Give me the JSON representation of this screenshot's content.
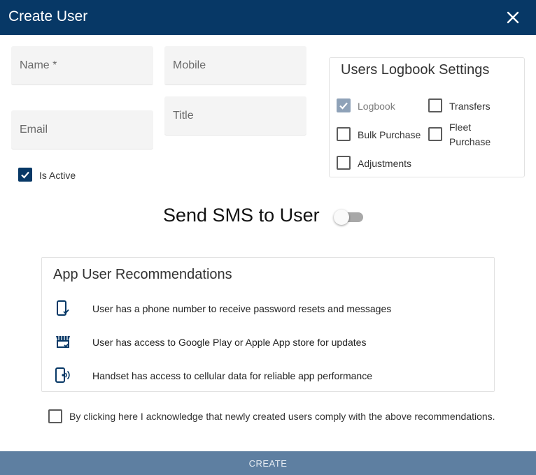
{
  "dialog": {
    "title": "Create User",
    "header_color": "#073866"
  },
  "fields": {
    "name_placeholder": "Name *",
    "mobile_placeholder": "Mobile",
    "title_placeholder": "Title",
    "email_placeholder": "Email"
  },
  "is_active": {
    "label": "Is Active",
    "checked": true
  },
  "logbook_settings": {
    "title": "Users Logbook Settings",
    "options": [
      {
        "label": "Logbook",
        "checked": true,
        "disabled": true
      },
      {
        "label": "Transfers",
        "checked": false
      },
      {
        "label": "Bulk Purchase",
        "checked": false
      },
      {
        "label": "Fleet",
        "label_line2": "Purchase",
        "checked": false
      },
      {
        "label": "Adjustments",
        "checked": false
      }
    ]
  },
  "sms": {
    "label": "Send SMS to User",
    "enabled": false
  },
  "recommendations": {
    "title": "App User Recommendations",
    "items": [
      {
        "icon": "phone-check-icon",
        "text": "User has a phone number to receive password resets and messages"
      },
      {
        "icon": "store-check-icon",
        "text": "User has access to Google Play or Apple App store for updates"
      },
      {
        "icon": "phone-signal-icon",
        "text": "Handset has access to cellular data for reliable app performance"
      }
    ]
  },
  "acknowledge": {
    "label": "By clicking here I acknowledge that newly created users comply with the above recommendations.",
    "checked": false
  },
  "actions": {
    "create_label": "CREATE",
    "create_color": "#5e7fa1"
  }
}
